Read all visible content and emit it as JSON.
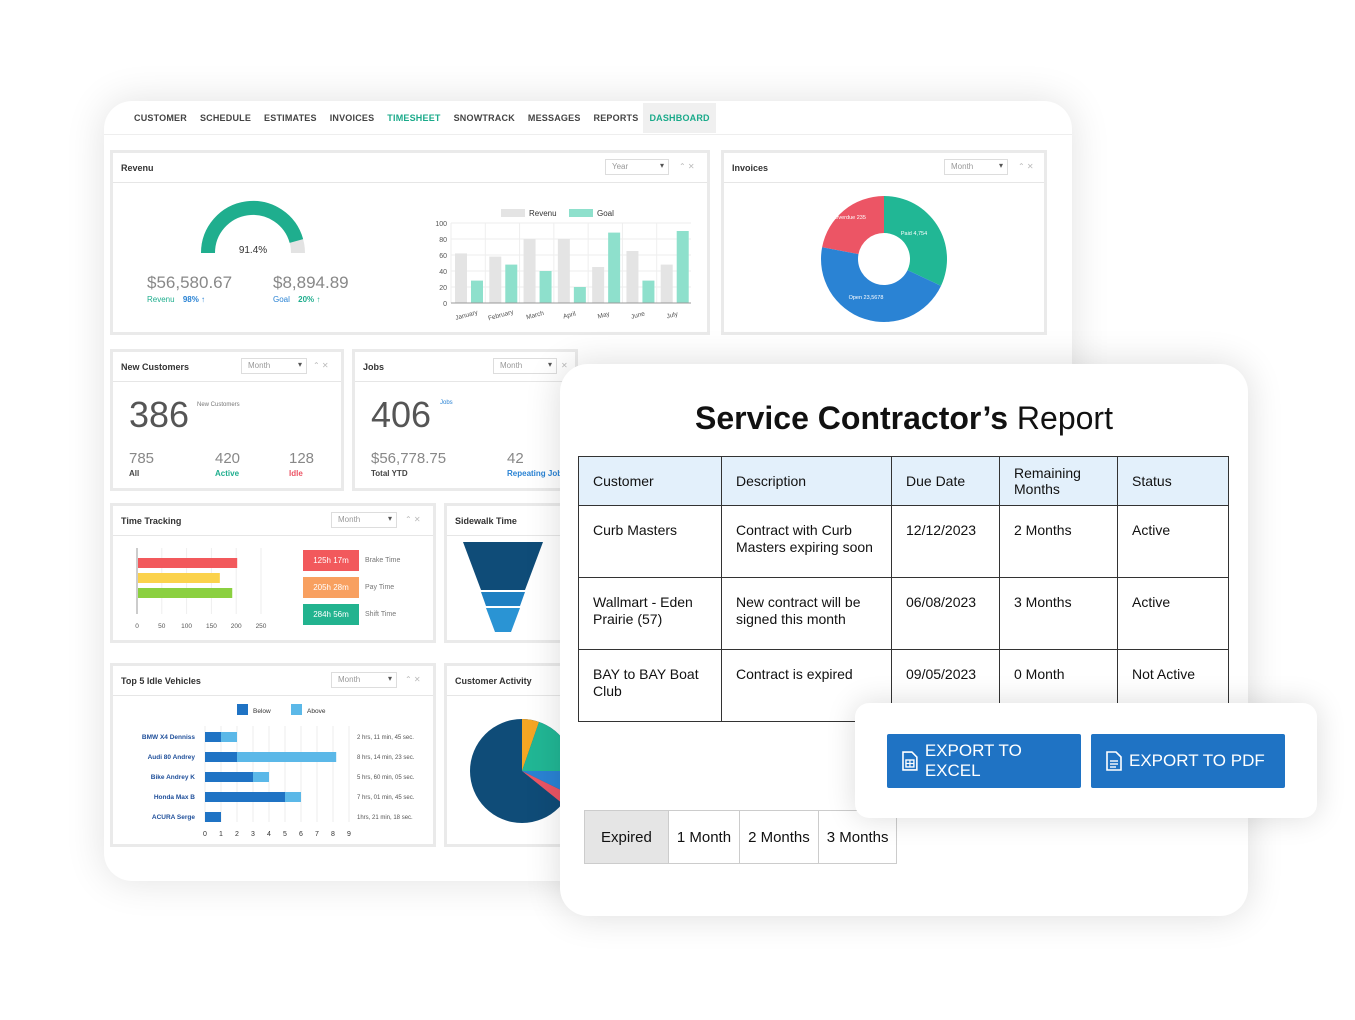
{
  "nav": [
    "CUSTOMER",
    "SCHEDULE",
    "ESTIMATES",
    "INVOICES",
    "TIMESHEET",
    "SNOWTRACK",
    "MESSAGES",
    "REPORTS",
    "DASHBOARD"
  ],
  "revenue": {
    "title": "Revenu",
    "select": "Year",
    "gauge_pct": "91.4%",
    "gauge_fraction": 0.914,
    "amount": "$56,580.67",
    "amount_label": "Revenu",
    "amount_pct": "98% ↑",
    "goal": "$8,894.89",
    "goal_label": "Goal",
    "goal_pct": "20% ↑",
    "legend": [
      "Revenu",
      "Goal"
    ]
  },
  "chart_data": [
    {
      "type": "bar",
      "categories": [
        "January",
        "February",
        "March",
        "April",
        "May",
        "June",
        "July"
      ],
      "series": [
        {
          "name": "Revenu",
          "values": [
            62,
            58,
            80,
            80,
            45,
            65,
            48
          ]
        },
        {
          "name": "Goal",
          "values": [
            28,
            48,
            40,
            20,
            88,
            28,
            90
          ]
        }
      ],
      "ylim": [
        0,
        100
      ],
      "yticks": [
        "100",
        "80",
        "60",
        "40",
        "20",
        "0"
      ],
      "colors": [
        "#e4e4e4",
        "#8ee0cc"
      ]
    },
    {
      "type": "pie",
      "title": "Invoices",
      "labels": [
        "Overdue 235",
        "Paid 4,754",
        "Open 23,5678"
      ],
      "values": [
        22,
        32,
        46
      ],
      "colors": [
        "#ec5565",
        "#21b795",
        "#2a83d4"
      ]
    },
    {
      "type": "bar",
      "title": "Top 5 Idle Vehicles",
      "categories": [
        "BMW X4 Denniss",
        "Audi 80 Andrey",
        "Bike Andrey K",
        "Honda Max B",
        "ACURA Serge"
      ],
      "series": [
        {
          "name": "Below",
          "values": [
            1,
            2,
            3,
            5,
            1
          ]
        },
        {
          "name": "Above",
          "values": [
            1,
            6.2,
            1,
            1,
            0
          ]
        }
      ],
      "xticks": [
        "0",
        "1",
        "2",
        "3",
        "4",
        "5",
        "6",
        "7",
        "8",
        "9"
      ]
    }
  ],
  "invoices": {
    "title": "Invoices",
    "select": "Month"
  },
  "new_customers": {
    "title": "New Customers",
    "select": "Month",
    "big": "386",
    "big_label": "New Customers",
    "all": "785",
    "all_label": "All",
    "active": "420",
    "active_label": "Active",
    "idle": "128",
    "idle_label": "Idle"
  },
  "jobs": {
    "title": "Jobs",
    "select": "Month",
    "big": "406",
    "big_label": "Jobs",
    "total": "$56,778.75",
    "total_label": "Total YTD",
    "rep": "42",
    "rep_label": "Repeating Jobs"
  },
  "time_tracking": {
    "title": "Time Tracking",
    "select": "Month",
    "xticks": [
      "0",
      "50",
      "100",
      "150",
      "200",
      "250"
    ],
    "items": [
      {
        "value": "125h 17m",
        "label": "Brake Time",
        "color": "#f2595c"
      },
      {
        "value": "205h 28m",
        "label": "Pay Time",
        "color": "#f8a060"
      },
      {
        "value": "284h 56m",
        "label": "Shift Time",
        "color": "#22b38f"
      }
    ]
  },
  "sidewalk": {
    "title": "Sidewalk Time"
  },
  "idle": {
    "title": "Top 5 Idle Vehicles",
    "select": "Month",
    "times": [
      "2 hrs, 11 min, 45 sec.",
      "8 hrs, 14 min, 23 sec.",
      "5 hrs, 60 min, 05 sec.",
      "7 hrs, 01 min, 45 sec.",
      "1hrs, 21 min, 18 sec."
    ]
  },
  "activity": {
    "title": "Customer Activity"
  },
  "report": {
    "title_bold": "Service Contractor’s",
    "title_rest": " Report",
    "headers": [
      "Customer",
      "Description",
      "Due Date",
      "Remaining Months",
      "Status"
    ],
    "rows": [
      [
        "Curb Masters",
        "Contract with Curb Masters expiring soon",
        "12/12/2023",
        "2 Months",
        "Active"
      ],
      [
        "Wallmart - Eden Prairie (57)",
        "New contract will be signed this month",
        "06/08/2023",
        "3 Months",
        "Active"
      ],
      [
        "BAY to BAY Boat Club",
        "Contract is expired",
        "09/05/2023",
        "0 Month",
        "Not Active"
      ]
    ],
    "tabs": [
      "Expired",
      "1 Month",
      "2 Months",
      "3 Months"
    ]
  },
  "export": {
    "excel": "EXPORT TO EXCEL",
    "pdf": "EXPORT TO PDF"
  }
}
